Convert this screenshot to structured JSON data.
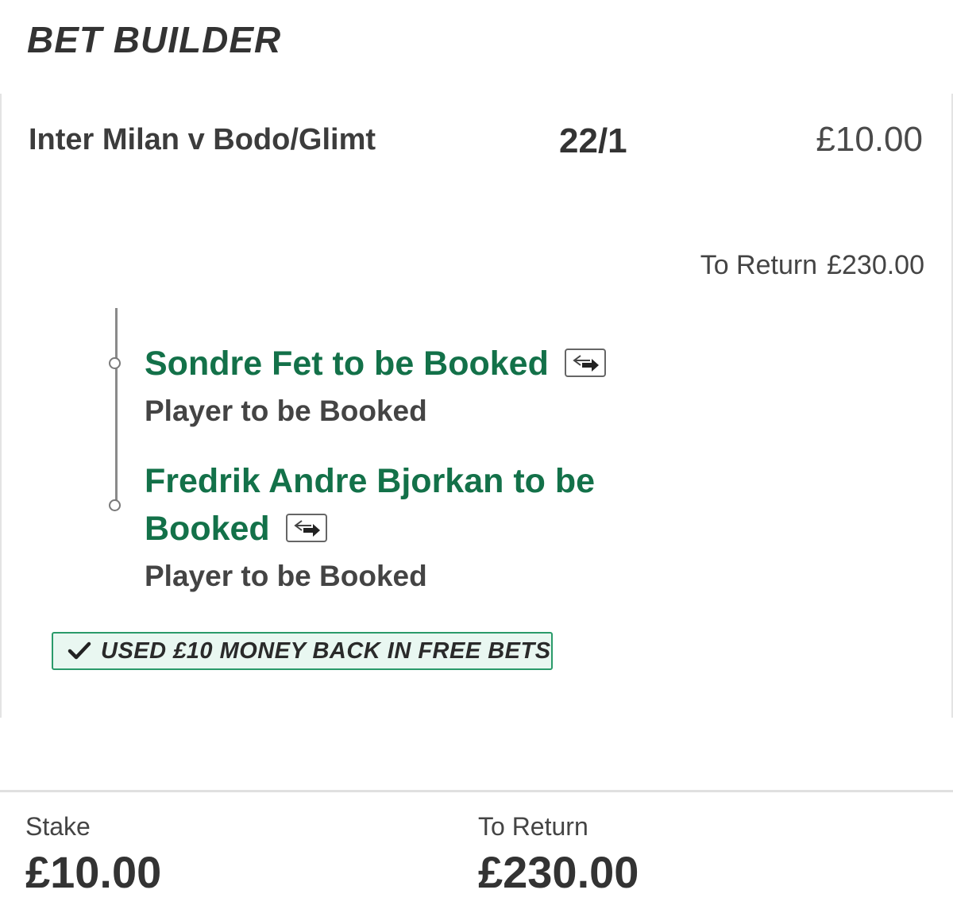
{
  "header": {
    "title": "BET BUILDER"
  },
  "bet": {
    "event": "Inter Milan v Bodo/Glimt",
    "odds": "22/1",
    "stake": "£10.00",
    "to_return_label": "To Return",
    "to_return_value": "£230.00",
    "selections": [
      {
        "name": "Sondre Fet to be Booked",
        "market": "Player to be Booked",
        "icon": "swap-icon"
      },
      {
        "name_line1": "Fredrik Andre Bjorkan to be",
        "name_line2": "Booked",
        "market": "Player to be Booked",
        "icon": "swap-icon"
      }
    ],
    "promo": {
      "text": "USED £10 MONEY BACK IN FREE BETS",
      "icon": "checkmark-icon",
      "accent": "#2a9a6a"
    }
  },
  "summary": {
    "stake_label": "Stake",
    "stake_value": "£10.00",
    "return_label": "To Return",
    "return_value": "£230.00"
  },
  "colors": {
    "selection_green": "#137149",
    "text_dark": "#333333",
    "promo_bg": "#e9f7f1"
  }
}
